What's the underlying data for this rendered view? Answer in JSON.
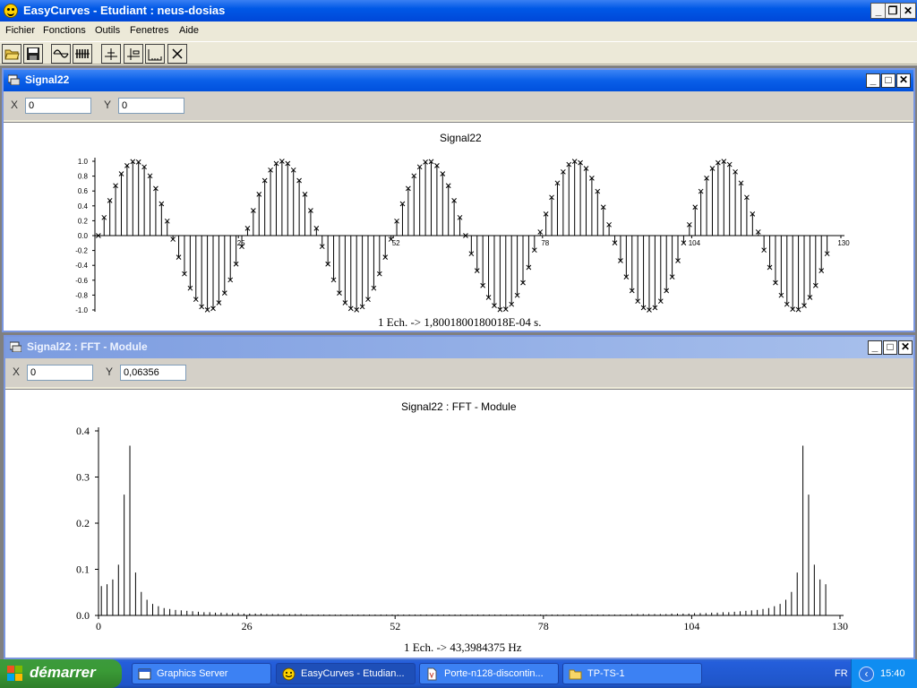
{
  "app": {
    "title": "EasyCurves - Etudiant : neus-dosias",
    "controls": {
      "minimize": "_",
      "restore": "❐",
      "close": "✕"
    }
  },
  "menu": [
    "Fichier",
    "Fonctions",
    "Outils",
    "Fenetres",
    "Aide"
  ],
  "toolbar": {
    "buttons": [
      "open-folder-icon",
      "save-icon",
      "signal-generator-icon",
      "sample-icon",
      "add-marker-icon",
      "marker-cursor-icon",
      "histogram-icon",
      "close-icon"
    ]
  },
  "signal_window": {
    "title": "Signal22",
    "x_label": "X",
    "x_value": "0",
    "y_label": "Y",
    "y_value": "0",
    "controls": {
      "minimize": "_",
      "maximize": "□",
      "close": "✕"
    }
  },
  "fft_window": {
    "title": "Signal22 : FFT - Module",
    "x_label": "X",
    "x_value": "0",
    "y_label": "Y",
    "y_value": "0,06356",
    "controls": {
      "minimize": "_",
      "maximize": "□",
      "close": "✕"
    }
  },
  "chart_data": [
    {
      "type": "stem",
      "title": "Signal22",
      "footer": "1 Ech. -> 1,8001800180018E-04 s.",
      "x_ticks": [
        "25",
        "52",
        "78",
        "104",
        "130"
      ],
      "y_ticks": [
        "1.0",
        "0.8",
        "0.6",
        "0.4",
        "0.2",
        "0.0",
        "-0.2",
        "-0.4",
        "-0.6",
        "-0.8",
        "-1.0"
      ],
      "xlim": [
        0,
        130
      ],
      "ylim": [
        -1.0,
        1.0
      ],
      "samples": 128,
      "signal": "sine",
      "period_samples": 25.6,
      "amplitude": 1.0,
      "marker": "x"
    },
    {
      "type": "stem",
      "title": "Signal22 : FFT - Module",
      "footer": "1 Ech. -> 43,3984375 Hz",
      "x_ticks": [
        "0",
        "26",
        "52",
        "78",
        "104",
        "130"
      ],
      "y_ticks": [
        "0.4",
        "0.3",
        "0.2",
        "0.1",
        "0.0"
      ],
      "xlim": [
        0,
        130
      ],
      "ylim": [
        0,
        0.4
      ],
      "samples": 128,
      "peak_bin": 5,
      "values_head": [
        0.0636,
        0.0676,
        0.078,
        0.11,
        0.262,
        0.368,
        0.093,
        0.051,
        0.034,
        0.025,
        0.02,
        0.016,
        0.014,
        0.012,
        0.011,
        0.01,
        0.009,
        0.008,
        0.007,
        0.007,
        0.006,
        0.006,
        0.005,
        0.005,
        0.005,
        0.004,
        0.004,
        0.004,
        0.004,
        0.003,
        0.003,
        0.003,
        0.003,
        0.003,
        0.003,
        0.003,
        0.002,
        0.002,
        0.002,
        0.002,
        0.002,
        0.002,
        0.002,
        0.002,
        0.002,
        0.002,
        0.002,
        0.002,
        0.002,
        0.002,
        0.002,
        0.002,
        0.002,
        0.002,
        0.002,
        0.002,
        0.002,
        0.002,
        0.002,
        0.002,
        0.002,
        0.002,
        0.002,
        0.002,
        0.002
      ],
      "symmetric": true
    }
  ],
  "taskbar": {
    "start_label": "démarrer",
    "tasks": [
      {
        "label": "Graphics Server",
        "icon": "window-icon"
      },
      {
        "label": "EasyCurves - Etudian...",
        "icon": "easycurves-icon"
      },
      {
        "label": "Porte-n128-discontin...",
        "icon": "document-icon"
      },
      {
        "label": "TP-TS-1",
        "icon": "folder-icon"
      }
    ],
    "language": "FR",
    "clock": "15:40"
  }
}
